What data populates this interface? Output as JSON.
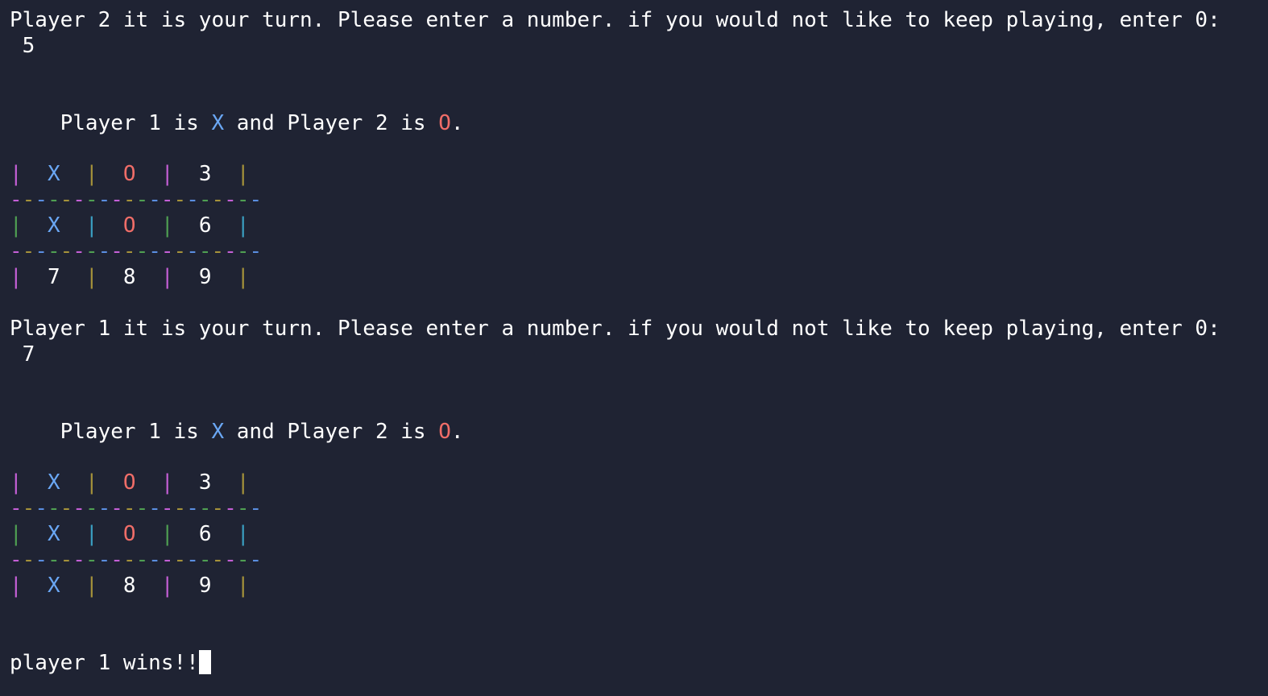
{
  "colors": {
    "background": "#1f2333",
    "text": "#ffffff",
    "x_mark": "#6aa7f4",
    "o_mark": "#ef6d68",
    "magenta": "#c45fd6",
    "gold": "#a5923a",
    "green": "#4f9f52",
    "cyan": "#3a9fc1",
    "blue": "#5a8ee0"
  },
  "transcript": {
    "prompt_p2": "Player 2 it is your turn. Please enter a number. if you would not like to keep playing, enter 0:",
    "input_p2": " 5",
    "info1": {
      "prefix": "Player 1 is ",
      "x": "X",
      "middle": " and Player 2 is ",
      "o": "O",
      "suffix": "."
    },
    "board1": [
      [
        {
          "text": "X",
          "color": "#6aa7f4"
        },
        {
          "text": "O",
          "color": "#ef6d68"
        },
        {
          "text": "3",
          "color": "#ffffff"
        }
      ],
      [
        {
          "text": "X",
          "color": "#6aa7f4"
        },
        {
          "text": "O",
          "color": "#ef6d68"
        },
        {
          "text": "6",
          "color": "#ffffff"
        }
      ],
      [
        {
          "text": "7",
          "color": "#ffffff"
        },
        {
          "text": "8",
          "color": "#ffffff"
        },
        {
          "text": "9",
          "color": "#ffffff"
        }
      ]
    ],
    "prompt_p1": "Player 1 it is your turn. Please enter a number. if you would not like to keep playing, enter 0:",
    "input_p1": " 7",
    "info2": {
      "prefix": "Player 1 is ",
      "x": "X",
      "middle": " and Player 2 is ",
      "o": "O",
      "suffix": "."
    },
    "board2": [
      [
        {
          "text": "X",
          "color": "#6aa7f4"
        },
        {
          "text": "O",
          "color": "#ef6d68"
        },
        {
          "text": "3",
          "color": "#ffffff"
        }
      ],
      [
        {
          "text": "X",
          "color": "#6aa7f4"
        },
        {
          "text": "O",
          "color": "#ef6d68"
        },
        {
          "text": "6",
          "color": "#ffffff"
        }
      ],
      [
        {
          "text": "X",
          "color": "#6aa7f4"
        },
        {
          "text": "8",
          "color": "#ffffff"
        },
        {
          "text": "9",
          "color": "#ffffff"
        }
      ]
    ],
    "result": "player 1 wins!!"
  },
  "board_style": {
    "row_pipe_colors": [
      [
        "#c45fd6",
        "#a5923a",
        "#c45fd6",
        "#a5923a"
      ],
      [
        "#4f9f52",
        "#3a9fc1",
        "#4f9f52",
        "#3a9fc1"
      ],
      [
        "#c45fd6",
        "#a5923a",
        "#c45fd6",
        "#a5923a"
      ]
    ],
    "separator_dash_colors": [
      "#c45fd6",
      "#a5923a",
      "#5a8ee0",
      "#4f9f52",
      "#a5923a",
      "#c45fd6",
      "#4f9f52",
      "#5a8ee0",
      "#c45fd6",
      "#a5923a",
      "#4f9f52",
      "#5a8ee0",
      "#c45fd6",
      "#a5923a",
      "#5a8ee0",
      "#4f9f52",
      "#a5923a",
      "#c45fd6",
      "#4f9f52",
      "#5a8ee0"
    ]
  }
}
